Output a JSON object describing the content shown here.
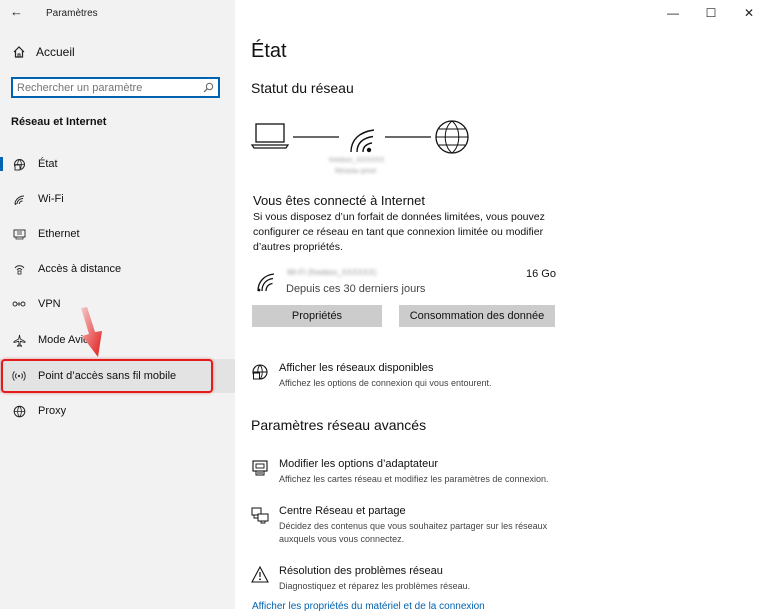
{
  "app": {
    "title": "Paramètres"
  },
  "sidebar": {
    "home_label": "Accueil",
    "search_placeholder": "Rechercher un paramètre",
    "section_title": "Réseau et Internet",
    "items": [
      {
        "label": "État",
        "icon": "globe-status-icon"
      },
      {
        "label": "Wi-Fi",
        "icon": "wifi-icon"
      },
      {
        "label": "Ethernet",
        "icon": "ethernet-icon"
      },
      {
        "label": "Accès à distance",
        "icon": "dialup-icon"
      },
      {
        "label": "VPN",
        "icon": "vpn-icon"
      },
      {
        "label": "Mode Avion",
        "icon": "airplane-icon"
      },
      {
        "label": "Point d’accès sans fil mobile",
        "icon": "hotspot-icon"
      },
      {
        "label": "Proxy",
        "icon": "globe-icon"
      }
    ]
  },
  "window_controls": {
    "minimize": "—",
    "maximize": "☐",
    "close": "✕"
  },
  "main": {
    "title": "État",
    "network_status_title": "Statut du réseau",
    "network_name_blurred": "freebox_XXXXXX",
    "network_type_blurred": "Réseau privé",
    "connected_title": "Vous êtes connecté à Internet",
    "connected_desc": "Si vous disposez d’un forfait de données limitées, vous pouvez configurer ce réseau en tant que connexion limitée ou modifier d’autres propriétés.",
    "wifi_name_blurred": "Wi-Fi (freebox_XXXXXX)",
    "usage_amount": "16 Go",
    "usage_period": "Depuis ces 30 derniers jours",
    "properties_button": "Propriétés",
    "data_usage_button": "Consommation des donnée",
    "show_networks_title": "Afficher les réseaux disponibles",
    "show_networks_desc": "Affichez les options de connexion qui vous entourent.",
    "advanced_title": "Paramètres réseau avancés",
    "adapter_title": "Modifier les options d’adaptateur",
    "adapter_desc": "Affichez les cartes réseau et modifiez les paramètres de connexion.",
    "sharing_title": "Centre Réseau et partage",
    "sharing_desc": "Décidez des contenus que vous souhaitez partager sur les réseaux auxquels vous vous connectez.",
    "troubleshoot_title": "Résolution des problèmes réseau",
    "troubleshoot_desc": "Diagnostiquez et réparez les problèmes réseau.",
    "footer_link": "Afficher les propriétés du matériel et de la connexion"
  }
}
